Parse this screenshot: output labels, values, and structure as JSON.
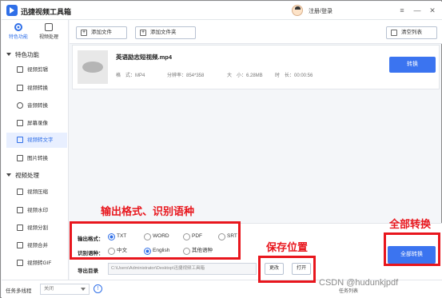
{
  "app": {
    "title": "迅捷视频工具箱",
    "login": "注册/登录"
  },
  "window_controls": [
    "≡",
    "—",
    "✕"
  ],
  "sidebar": {
    "tabs": [
      {
        "label": "特色功能",
        "active": true,
        "icon": "feature-icon"
      },
      {
        "label": "视频处理",
        "active": false,
        "icon": "video-icon"
      }
    ],
    "sections": [
      {
        "title": "特色功能",
        "items": [
          {
            "label": "视频剪辑"
          },
          {
            "label": "视频转换"
          },
          {
            "label": "音频转换"
          },
          {
            "label": "屏幕录像"
          },
          {
            "label": "视频转文字",
            "active": true
          },
          {
            "label": "图片转换"
          }
        ]
      },
      {
        "title": "视频处理",
        "items": [
          {
            "label": "视频压缩"
          },
          {
            "label": "视频水印"
          },
          {
            "label": "视频分割"
          },
          {
            "label": "视频合并"
          },
          {
            "label": "视频转GIF"
          }
        ]
      }
    ]
  },
  "toolbar": {
    "add_file": "添加文件",
    "add_folder": "添加文件夹",
    "clear_list": "清空列表"
  },
  "file": {
    "name": "英语励志短视频.mp4",
    "format": "格　式：MP4",
    "resolution": "分辨率：854*358",
    "size": "大　小：6.28MB",
    "duration": "时　长：00:00:56",
    "convert_label": "转换"
  },
  "settings": {
    "output_format_label": "输出格式：",
    "formats": [
      {
        "label": "TXT",
        "checked": true
      },
      {
        "label": "WORD",
        "checked": false
      },
      {
        "label": "PDF",
        "checked": false
      },
      {
        "label": "SRT",
        "checked": false
      }
    ],
    "language_label": "识别语种：",
    "languages": [
      {
        "label": "中文",
        "checked": false
      },
      {
        "label": "English",
        "checked": true
      },
      {
        "label": "其他语种",
        "checked": false
      }
    ],
    "output_dir_label": "导出目录",
    "output_dir": "C:\\Users\\Administrator\\Desktop\\迅捷视频工具箱",
    "change_label": "更改",
    "open_label": "打开",
    "convert_all_label": "全部转换"
  },
  "statusbar": {
    "task_label": "任务多线程",
    "task_value": "关闭",
    "right_text": "任务列表"
  },
  "annotations": {
    "format_language": "输出格式、识别语种",
    "save_location": "保存位置",
    "convert_all": "全部转换",
    "color": "#e8161d"
  },
  "watermark": "CSDN @hudunkjpdf"
}
